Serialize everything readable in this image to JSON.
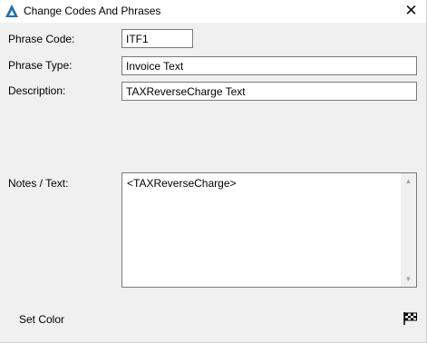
{
  "window": {
    "title": "Change Codes And Phrases",
    "close_glyph": "✕",
    "icon": "app-logo-icon"
  },
  "form": {
    "phrase_code": {
      "label": "Phrase Code:",
      "value": "ITF1"
    },
    "phrase_type": {
      "label": "Phrase Type:",
      "value": "Invoice Text"
    },
    "description": {
      "label": "Description:",
      "value": "TAXReverseCharge Text"
    },
    "notes": {
      "label": "Notes / Text:",
      "value": "<TAXReverseCharge>"
    }
  },
  "footer": {
    "set_color_label": "Set Color",
    "flag_icon": "checkered-flag-icon"
  },
  "colors": {
    "accent": "#1d6fa5",
    "background": "#f0f0f0"
  }
}
